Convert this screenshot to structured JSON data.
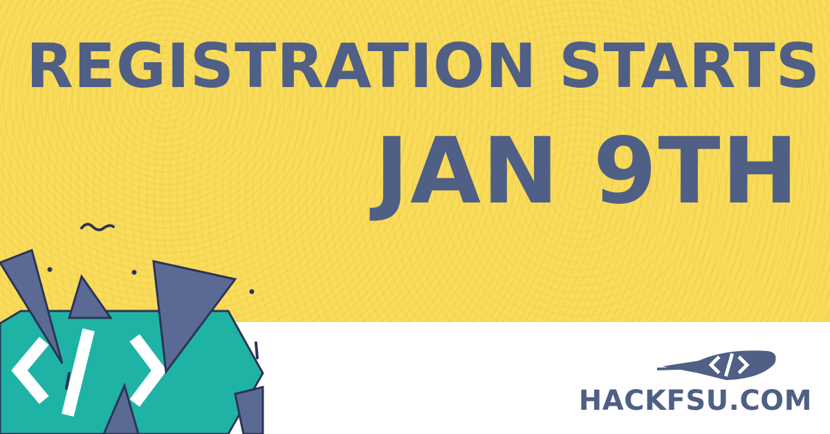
{
  "headline": "REGISTRATION STARTS",
  "date": "JAN 9TH",
  "site_url": "HACKFSU.COM",
  "colors": {
    "yellow": "#f9dc5c",
    "navy": "#4f5f85",
    "teal": "#1fb3a6",
    "white": "#ffffff",
    "outline": "#2b3355"
  },
  "icons": {
    "code_brackets": "code-brackets-icon",
    "logo": "quill-code-logo"
  }
}
